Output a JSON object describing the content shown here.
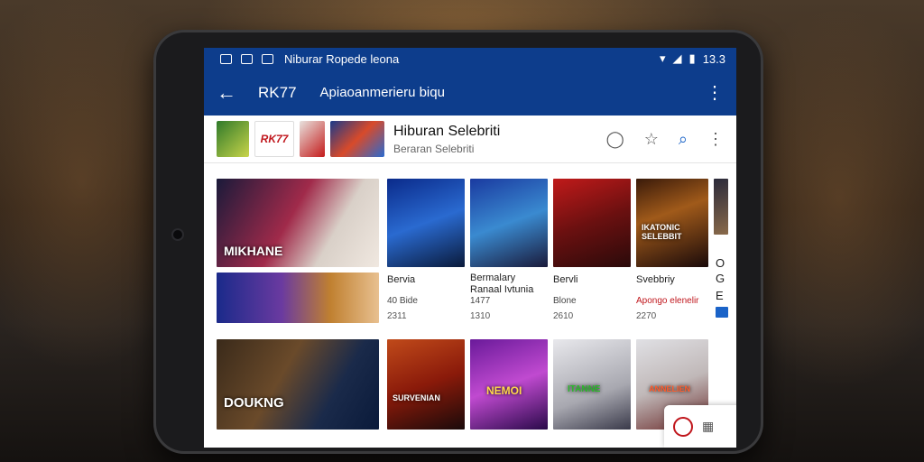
{
  "statusbar": {
    "title": "Niburar Ropede leona",
    "time": "13.3"
  },
  "appbar": {
    "title": "RK77",
    "subtitle": "Apiaoanmerieru biqu"
  },
  "header": {
    "logo_text": "RK77",
    "title": "Hiburan Selebriti",
    "subtitle": "Beraran Selebriti"
  },
  "cards_row1": [
    {
      "overlay": "MIKHANE",
      "title": "",
      "meta": "",
      "views": ""
    },
    {
      "title": "Bervia",
      "meta": "40 Bide",
      "views": "2311"
    },
    {
      "title": "Bermalary Ranaal Ivtunia",
      "meta": "1477",
      "views": "1310"
    },
    {
      "title": "Bervli",
      "meta": "Blone",
      "views": "2610"
    },
    {
      "title": "Svebbriy",
      "meta": "Apongo elenelir",
      "views": "2270",
      "overlay": "IKATONIC SELEBBIT"
    }
  ],
  "cards_row2": [
    {
      "overlay": "DOUKNG"
    },
    {
      "overlay": "SURVENIAN"
    },
    {
      "overlay": "NEMOI"
    },
    {
      "overlay": "ITANNE"
    },
    {
      "overlay": "ANNELIEN"
    }
  ],
  "partial_card": {
    "title": "O",
    "sub": "G",
    "meta": "E"
  }
}
